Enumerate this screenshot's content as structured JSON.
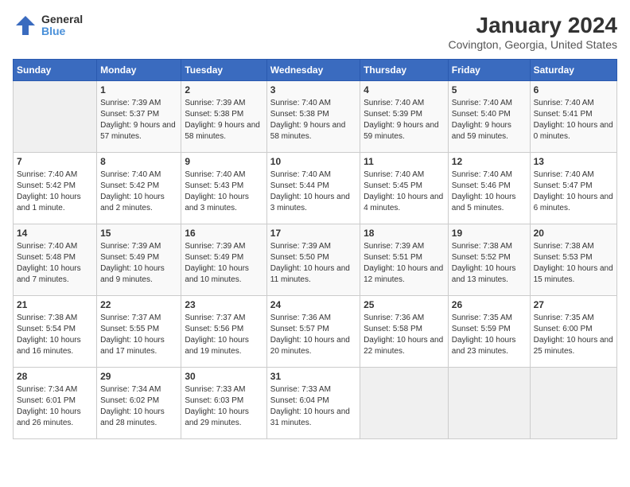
{
  "header": {
    "logo_general": "General",
    "logo_blue": "Blue",
    "title": "January 2024",
    "subtitle": "Covington, Georgia, United States"
  },
  "weekdays": [
    "Sunday",
    "Monday",
    "Tuesday",
    "Wednesday",
    "Thursday",
    "Friday",
    "Saturday"
  ],
  "weeks": [
    [
      {
        "day": "",
        "sunrise": "",
        "sunset": "",
        "daylight": ""
      },
      {
        "day": "1",
        "sunrise": "Sunrise: 7:39 AM",
        "sunset": "Sunset: 5:37 PM",
        "daylight": "Daylight: 9 hours and 57 minutes."
      },
      {
        "day": "2",
        "sunrise": "Sunrise: 7:39 AM",
        "sunset": "Sunset: 5:38 PM",
        "daylight": "Daylight: 9 hours and 58 minutes."
      },
      {
        "day": "3",
        "sunrise": "Sunrise: 7:40 AM",
        "sunset": "Sunset: 5:38 PM",
        "daylight": "Daylight: 9 hours and 58 minutes."
      },
      {
        "day": "4",
        "sunrise": "Sunrise: 7:40 AM",
        "sunset": "Sunset: 5:39 PM",
        "daylight": "Daylight: 9 hours and 59 minutes."
      },
      {
        "day": "5",
        "sunrise": "Sunrise: 7:40 AM",
        "sunset": "Sunset: 5:40 PM",
        "daylight": "Daylight: 9 hours and 59 minutes."
      },
      {
        "day": "6",
        "sunrise": "Sunrise: 7:40 AM",
        "sunset": "Sunset: 5:41 PM",
        "daylight": "Daylight: 10 hours and 0 minutes."
      }
    ],
    [
      {
        "day": "7",
        "sunrise": "Sunrise: 7:40 AM",
        "sunset": "Sunset: 5:42 PM",
        "daylight": "Daylight: 10 hours and 1 minute."
      },
      {
        "day": "8",
        "sunrise": "Sunrise: 7:40 AM",
        "sunset": "Sunset: 5:42 PM",
        "daylight": "Daylight: 10 hours and 2 minutes."
      },
      {
        "day": "9",
        "sunrise": "Sunrise: 7:40 AM",
        "sunset": "Sunset: 5:43 PM",
        "daylight": "Daylight: 10 hours and 3 minutes."
      },
      {
        "day": "10",
        "sunrise": "Sunrise: 7:40 AM",
        "sunset": "Sunset: 5:44 PM",
        "daylight": "Daylight: 10 hours and 3 minutes."
      },
      {
        "day": "11",
        "sunrise": "Sunrise: 7:40 AM",
        "sunset": "Sunset: 5:45 PM",
        "daylight": "Daylight: 10 hours and 4 minutes."
      },
      {
        "day": "12",
        "sunrise": "Sunrise: 7:40 AM",
        "sunset": "Sunset: 5:46 PM",
        "daylight": "Daylight: 10 hours and 5 minutes."
      },
      {
        "day": "13",
        "sunrise": "Sunrise: 7:40 AM",
        "sunset": "Sunset: 5:47 PM",
        "daylight": "Daylight: 10 hours and 6 minutes."
      }
    ],
    [
      {
        "day": "14",
        "sunrise": "Sunrise: 7:40 AM",
        "sunset": "Sunset: 5:48 PM",
        "daylight": "Daylight: 10 hours and 7 minutes."
      },
      {
        "day": "15",
        "sunrise": "Sunrise: 7:39 AM",
        "sunset": "Sunset: 5:49 PM",
        "daylight": "Daylight: 10 hours and 9 minutes."
      },
      {
        "day": "16",
        "sunrise": "Sunrise: 7:39 AM",
        "sunset": "Sunset: 5:49 PM",
        "daylight": "Daylight: 10 hours and 10 minutes."
      },
      {
        "day": "17",
        "sunrise": "Sunrise: 7:39 AM",
        "sunset": "Sunset: 5:50 PM",
        "daylight": "Daylight: 10 hours and 11 minutes."
      },
      {
        "day": "18",
        "sunrise": "Sunrise: 7:39 AM",
        "sunset": "Sunset: 5:51 PM",
        "daylight": "Daylight: 10 hours and 12 minutes."
      },
      {
        "day": "19",
        "sunrise": "Sunrise: 7:38 AM",
        "sunset": "Sunset: 5:52 PM",
        "daylight": "Daylight: 10 hours and 13 minutes."
      },
      {
        "day": "20",
        "sunrise": "Sunrise: 7:38 AM",
        "sunset": "Sunset: 5:53 PM",
        "daylight": "Daylight: 10 hours and 15 minutes."
      }
    ],
    [
      {
        "day": "21",
        "sunrise": "Sunrise: 7:38 AM",
        "sunset": "Sunset: 5:54 PM",
        "daylight": "Daylight: 10 hours and 16 minutes."
      },
      {
        "day": "22",
        "sunrise": "Sunrise: 7:37 AM",
        "sunset": "Sunset: 5:55 PM",
        "daylight": "Daylight: 10 hours and 17 minutes."
      },
      {
        "day": "23",
        "sunrise": "Sunrise: 7:37 AM",
        "sunset": "Sunset: 5:56 PM",
        "daylight": "Daylight: 10 hours and 19 minutes."
      },
      {
        "day": "24",
        "sunrise": "Sunrise: 7:36 AM",
        "sunset": "Sunset: 5:57 PM",
        "daylight": "Daylight: 10 hours and 20 minutes."
      },
      {
        "day": "25",
        "sunrise": "Sunrise: 7:36 AM",
        "sunset": "Sunset: 5:58 PM",
        "daylight": "Daylight: 10 hours and 22 minutes."
      },
      {
        "day": "26",
        "sunrise": "Sunrise: 7:35 AM",
        "sunset": "Sunset: 5:59 PM",
        "daylight": "Daylight: 10 hours and 23 minutes."
      },
      {
        "day": "27",
        "sunrise": "Sunrise: 7:35 AM",
        "sunset": "Sunset: 6:00 PM",
        "daylight": "Daylight: 10 hours and 25 minutes."
      }
    ],
    [
      {
        "day": "28",
        "sunrise": "Sunrise: 7:34 AM",
        "sunset": "Sunset: 6:01 PM",
        "daylight": "Daylight: 10 hours and 26 minutes."
      },
      {
        "day": "29",
        "sunrise": "Sunrise: 7:34 AM",
        "sunset": "Sunset: 6:02 PM",
        "daylight": "Daylight: 10 hours and 28 minutes."
      },
      {
        "day": "30",
        "sunrise": "Sunrise: 7:33 AM",
        "sunset": "Sunset: 6:03 PM",
        "daylight": "Daylight: 10 hours and 29 minutes."
      },
      {
        "day": "31",
        "sunrise": "Sunrise: 7:33 AM",
        "sunset": "Sunset: 6:04 PM",
        "daylight": "Daylight: 10 hours and 31 minutes."
      },
      {
        "day": "",
        "sunrise": "",
        "sunset": "",
        "daylight": ""
      },
      {
        "day": "",
        "sunrise": "",
        "sunset": "",
        "daylight": ""
      },
      {
        "day": "",
        "sunrise": "",
        "sunset": "",
        "daylight": ""
      }
    ]
  ]
}
